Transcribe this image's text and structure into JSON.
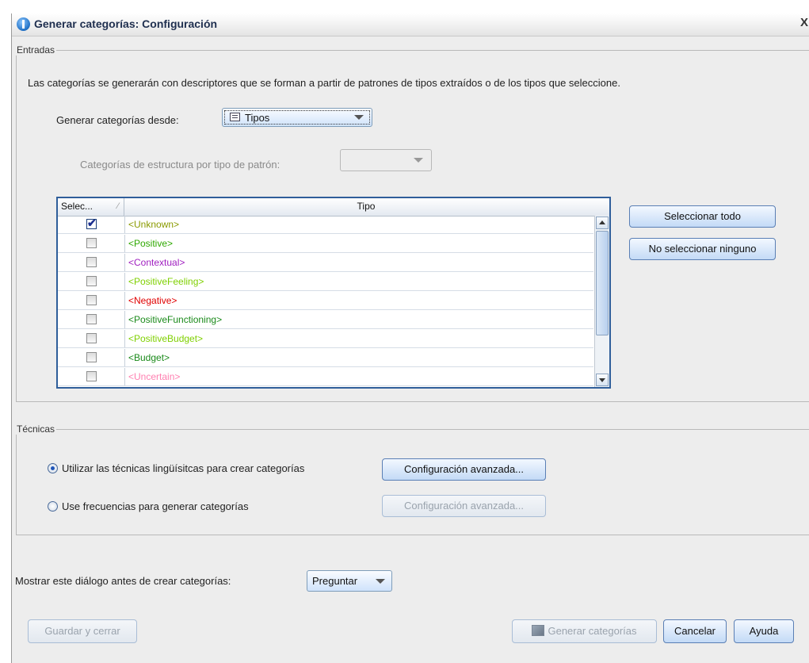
{
  "window": {
    "title": "Generar categorías: Configuración",
    "close": "X"
  },
  "entradas": {
    "legend": "Entradas",
    "description": "Las categorías se generarán con descriptores que se forman a partir de patrones de tipos extraídos o de los tipos que seleccione.",
    "source_label": "Generar categorías desde:",
    "source_value": "Tipos",
    "pattern_label": "Categorías de estructura por tipo de patrón:",
    "pattern_value": "",
    "table": {
      "headers": [
        "Selec...",
        "Tipo"
      ],
      "rows": [
        {
          "checked": true,
          "tipo": "<Unknown>",
          "color": "#8a9a00"
        },
        {
          "checked": false,
          "tipo": "<Positive>",
          "color": "#2ea800"
        },
        {
          "checked": false,
          "tipo": "<Contextual>",
          "color": "#a020c0"
        },
        {
          "checked": false,
          "tipo": "<PositiveFeeling>",
          "color": "#7fd000"
        },
        {
          "checked": false,
          "tipo": "<Negative>",
          "color": "#e00000"
        },
        {
          "checked": false,
          "tipo": "<PositiveFunctioning>",
          "color": "#1a8a1a"
        },
        {
          "checked": false,
          "tipo": "<PositiveBudget>",
          "color": "#7fd000"
        },
        {
          "checked": false,
          "tipo": "<Budget>",
          "color": "#1a8a1a"
        },
        {
          "checked": false,
          "tipo": "<Uncertain>",
          "color": "#ff7fb0"
        }
      ]
    },
    "select_all": "Seleccionar todo",
    "select_none": "No seleccionar ninguno"
  },
  "tecnicas": {
    "legend": "Técnicas",
    "option1": "Utilizar las técnicas lingüísitcas para crear categorías",
    "option2": "Use frecuencias para generar categorías",
    "advanced1": "Configuración avanzada...",
    "advanced2": "Configuración avanzada..."
  },
  "show_dialog": {
    "label": "Mostrar este diálogo antes de crear categorías:",
    "value": "Preguntar"
  },
  "footer": {
    "save_close": "Guardar y cerrar",
    "generate": "Generar categorías",
    "cancel": "Cancelar",
    "help": "Ayuda"
  }
}
